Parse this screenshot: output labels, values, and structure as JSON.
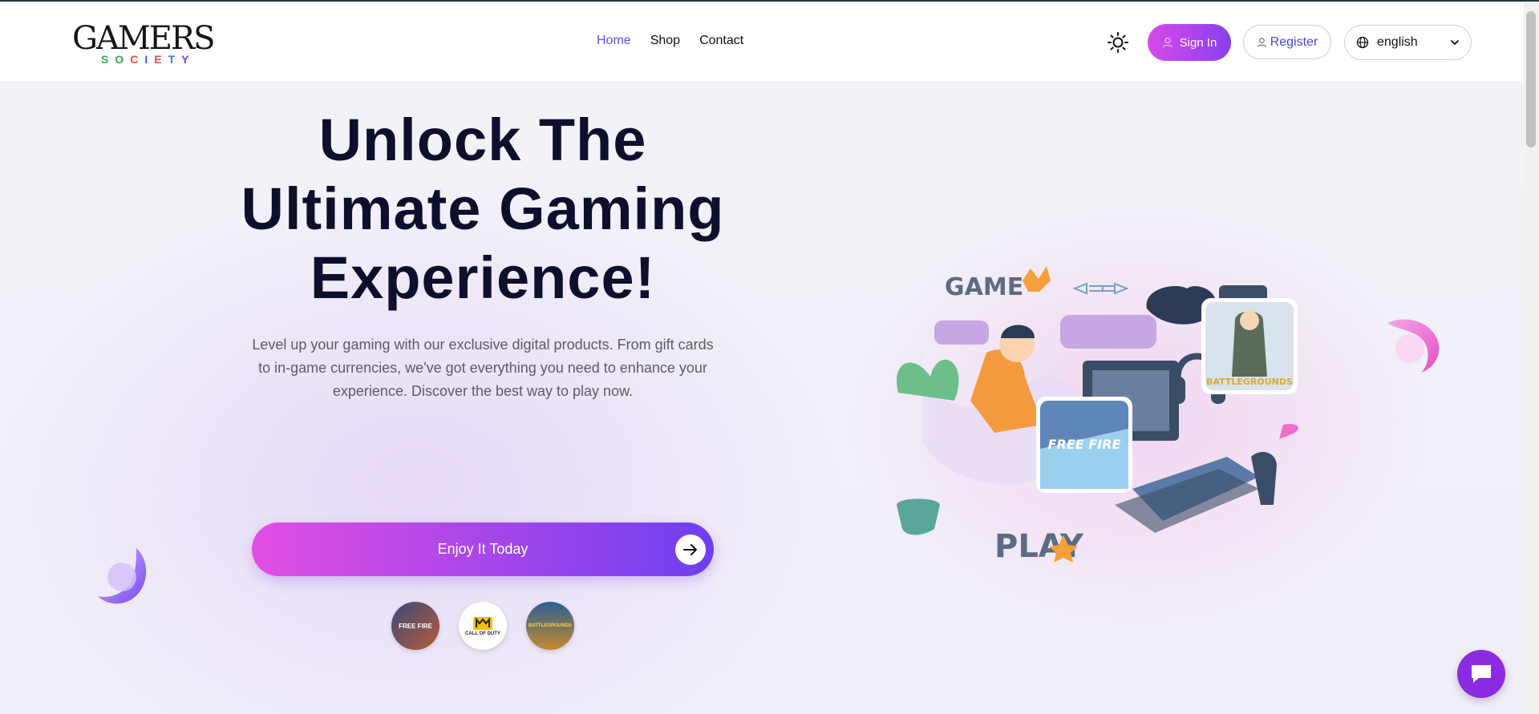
{
  "brand": {
    "logo_top": "GAMERS",
    "logo_sub_letters": [
      "S",
      "O",
      "C",
      "I",
      "E",
      "T",
      "Y"
    ]
  },
  "nav": {
    "items": [
      {
        "label": "Home",
        "active": true
      },
      {
        "label": "Shop",
        "active": false
      },
      {
        "label": "Contact",
        "active": false
      }
    ]
  },
  "header_actions": {
    "theme_icon": "sun-icon",
    "sign_in_label": "Sign In",
    "register_label": "Register",
    "language_value": "english"
  },
  "hero": {
    "title": "Unlock The Ultimate Gaming Experience!",
    "description": "Level up your gaming with our exclusive digital products. From gift cards to in-game currencies, we've got everything you need to enhance your experience. Discover the best way to play now.",
    "cta_label": "Enjoy It Today",
    "games": [
      {
        "label": "FREE FIRE"
      },
      {
        "label": "CALL OF DUTY"
      },
      {
        "label": "BATTLEGROUNDS"
      }
    ]
  },
  "illustration": {
    "game_label": "GAME",
    "play_label": "PLAY",
    "card_left": "FREE FIRE",
    "card_right": "BATTLEGROUNDS"
  },
  "colors": {
    "accent": "#6b4ae0",
    "gradient_start": "#e24fe2",
    "gradient_end": "#6d3ff0",
    "chat": "#8a2be2"
  }
}
